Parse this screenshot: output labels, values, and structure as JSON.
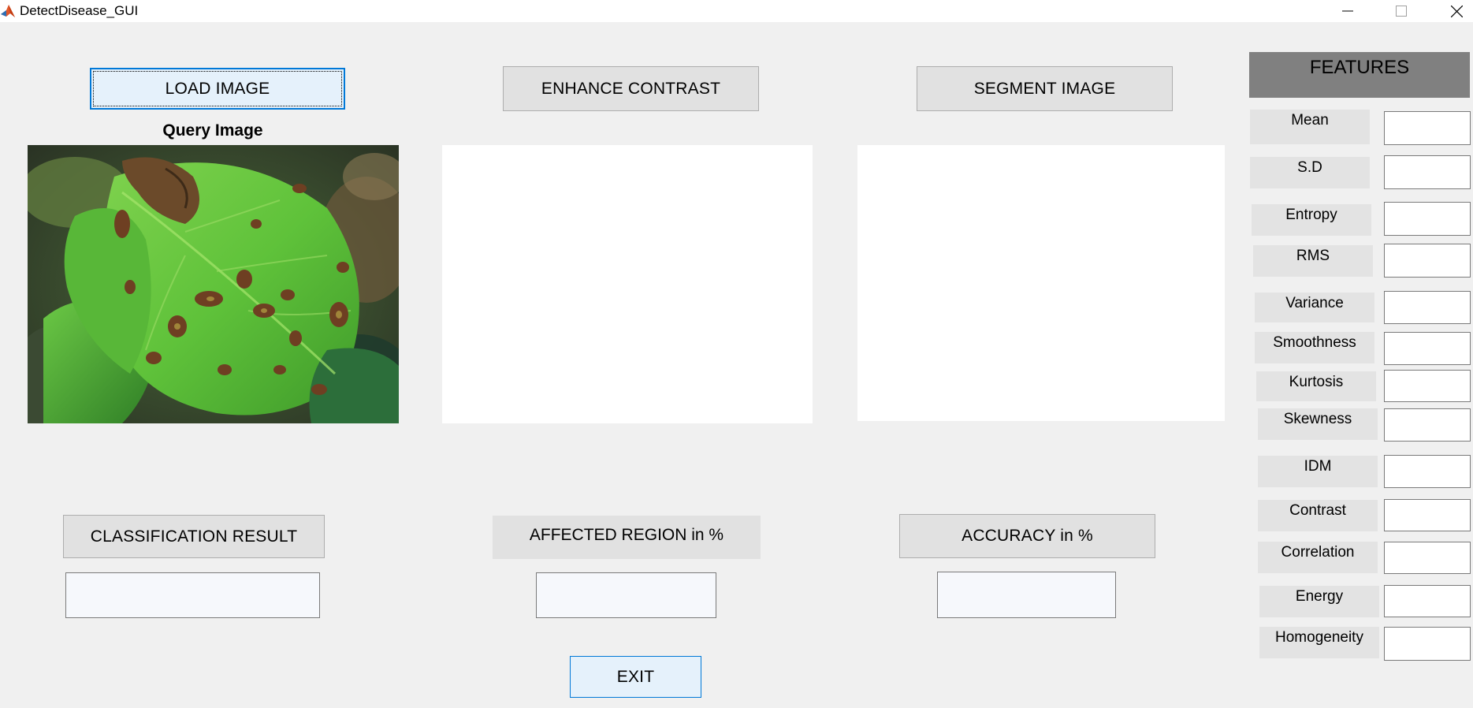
{
  "window": {
    "title": "DetectDisease_GUI",
    "controls": {
      "minimize": "minimize",
      "maximize": "maximize",
      "close": "close"
    }
  },
  "buttons": {
    "load_image": "LOAD IMAGE",
    "enhance_contrast": "ENHANCE CONTRAST",
    "segment_image": "SEGMENT IMAGE",
    "classification_result": "CLASSIFICATION RESULT",
    "accuracy": "ACCURACY in %",
    "exit": "EXIT"
  },
  "labels": {
    "query_image": "Query Image",
    "affected_region": "AFFECTED REGION in %"
  },
  "outputs": {
    "classification_result": "",
    "affected_region": "",
    "accuracy": ""
  },
  "features": {
    "header": "FEATURES",
    "items": [
      {
        "label": "Mean",
        "value": ""
      },
      {
        "label": "S.D",
        "value": ""
      },
      {
        "label": "Entropy",
        "value": ""
      },
      {
        "label": "RMS",
        "value": ""
      },
      {
        "label": "Variance",
        "value": ""
      },
      {
        "label": "Smoothness",
        "value": ""
      },
      {
        "label": "Kurtosis",
        "value": ""
      },
      {
        "label": "Skewness",
        "value": ""
      },
      {
        "label": "IDM",
        "value": ""
      },
      {
        "label": "Contrast",
        "value": ""
      },
      {
        "label": "Correlation",
        "value": ""
      },
      {
        "label": "Energy",
        "value": ""
      },
      {
        "label": "Homogeneity",
        "value": ""
      }
    ]
  },
  "colors": {
    "window_bg": "#f0f0f0",
    "button_bg": "#e1e1e1",
    "focus_accent": "#0078d7",
    "features_header_bg": "#808080"
  },
  "icons": {
    "app": "matlab-icon",
    "query_image": "diseased-leaf-photo"
  }
}
